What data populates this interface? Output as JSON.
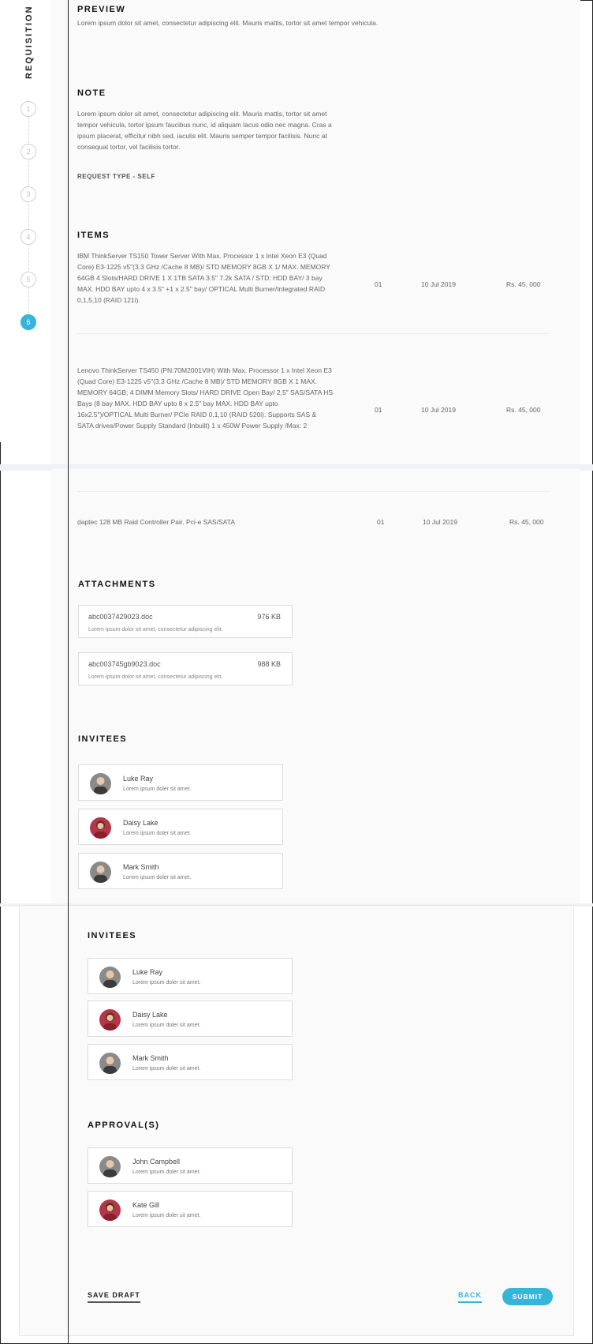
{
  "sidebar": {
    "title": "REQUISITION",
    "steps": [
      "1",
      "2",
      "3",
      "4",
      "5",
      "6"
    ],
    "active_step": "6"
  },
  "preview": {
    "heading": "PREVIEW",
    "text": "Lorem ipsum dolor sit amet, consectetur adipiscing elit. Mauris mattis, tortor sit amet tempor vehicula."
  },
  "note": {
    "heading": "NOTE",
    "text": "Lorem ipsum dolor sit amet, consectetur adipiscing elit. Mauris mattis, tortor sit amet tempor vehicula, tortor ipsum faucibus nunc, id aliquam lacus odio nec magna. Cras a ipsum placerat, efficitur nibh sed, iaculis elit. Mauris semper tempor facilisis. Nunc at consequat tortor, vel facilisis tortor.",
    "request_type": "REQUEST TYPE  - SELF"
  },
  "items": {
    "heading": "ITEMS",
    "rows": [
      {
        "desc": "IBM ThinkServer TS150 Tower Server With Max. Processor 1 x Intel Xeon E3 (Quad Core) E3-1225 v5\"(3.3 GHz /Cache 8 MB)/ STD MEMORY 8GB X 1/ MAX. MEMORY 64GB 4 Slots/HARD DRIVE 1 X 1TB SATA 3.5\" 7.2k SATA / STD: HDD BAY/ 3 bay MAX. HDD BAY upto 4 x 3.5\" +1 x 2.5\" bay/ OPTICAL Multi Burner/Integrated RAID 0,1,5,10 (RAID 121i).",
        "qty": "01",
        "date": "10 Jul 2019",
        "price": "Rs. 45, 000"
      },
      {
        "desc": "Lenovo ThinkServer TS450 (PN:70M2001VIH) With Max. Processor 1 x Intel Xeon E3 (Quad Core) E3-1225 v5\"(3.3 GHz /Cache 8 MB)/ STD MEMORY 8GB X 1 MAX. MEMORY 64GB; 4 DIMM Memory Slots/ HARD DRIVE Open Bay/ 2.5\" SAS/SATA HS Bays (8 bay MAX. HDD BAY upto 8 x 2.5\" bay MAX. HDD BAY upto 16x2.5\")/OPTICAL Multi Burner/ PCIe RAID 0,1,10 (RAID 520i). Supports SAS & SATA drives/Power Supply Standard (Inbuilt) 1 x 450W Power Supply /Max: 2",
        "qty": "01",
        "date": "10 Jul 2019",
        "price": "Rs. 45, 000"
      },
      {
        "desc": "daptec 128 MB Raid Controller Pair. Pci-e SAS/SATA",
        "qty": "01",
        "date": "10 Jul 2019",
        "price": "Rs. 45, 000"
      }
    ]
  },
  "attachments": {
    "heading": "ATTACHMENTS",
    "files": [
      {
        "name": "abc0037429023.doc",
        "size": "976 KB",
        "desc": "Lorem ipsum dolor sit amet, consectetur adipiscing elit."
      },
      {
        "name": "abc003745gb9023.doc",
        "size": "988 KB",
        "desc": "Lorem ipsum dolor sit amet, consectetur adipiscing elit."
      }
    ]
  },
  "invitees": {
    "heading": "INVITEES",
    "people": [
      {
        "name": "Luke Ray",
        "role": "Lorem ipsum doler sit amet."
      },
      {
        "name": "Daisy Lake",
        "role": "Lorem ipsum doler sit amet."
      },
      {
        "name": "Mark Smith",
        "role": "Lorem ipsum doler sit amet."
      }
    ]
  },
  "approvals": {
    "heading": "APPROVAL(S)",
    "people": [
      {
        "name": "John Campbell",
        "role": "Lorem ipsum doler sit amet."
      },
      {
        "name": "Kate Gill",
        "role": "Lorem ipsum doler sit amet."
      }
    ]
  },
  "footer": {
    "save_label": "SAVE DRAFT",
    "back_label": "BACK",
    "submit_label": "SUBMIT"
  },
  "colors": {
    "accent": "#36b5d8",
    "page_bg": "#fafafa"
  }
}
